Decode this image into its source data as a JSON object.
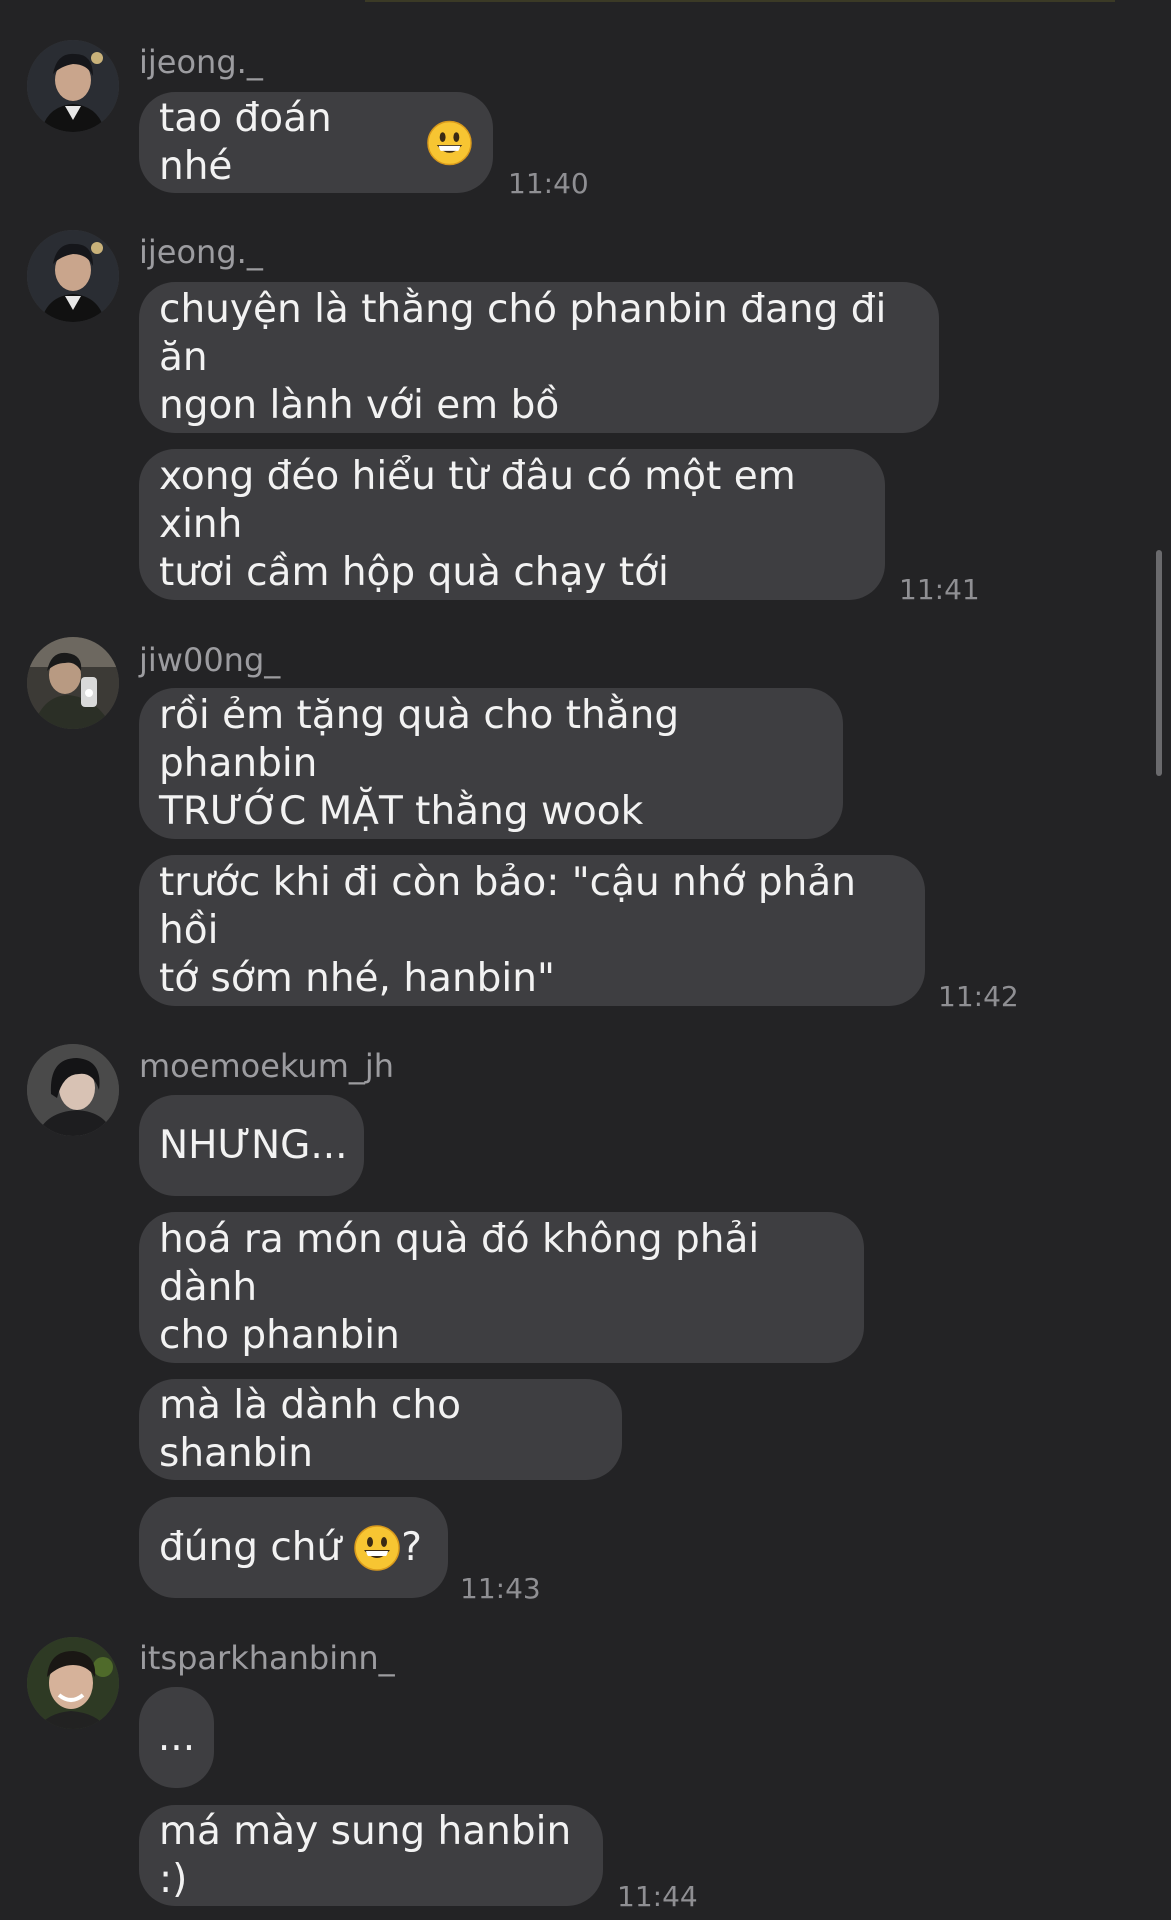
{
  "messages": [
    {
      "username": "ijeong._",
      "bubbles": [
        {
          "text": "tao đoán nhé",
          "trailing_emoji": "grinning-face-emoji"
        }
      ],
      "time": "11:40"
    },
    {
      "username": "ijeong._",
      "bubbles": [
        {
          "line1": "chuyện là thằng chó phanbin đang đi ăn",
          "line2": "ngon lành với em bồ"
        },
        {
          "line1": "xong đéo hiểu từ đâu có một em xinh",
          "line2": "tươi cầm hộp quà chạy tới"
        }
      ],
      "time": "11:41"
    },
    {
      "username": "jiw00ng_",
      "bubbles": [
        {
          "line1": "rồi ẻm tặng quà cho thằng phanbin",
          "line2": "TRƯỚC MẶT thằng wook"
        },
        {
          "line1": "trước khi đi còn bảo: \"cậu nhớ phản hồi",
          "line2": "tớ sớm nhé, hanbin\""
        }
      ],
      "time": "11:42"
    },
    {
      "username": "moemoekum_jh",
      "bubbles": [
        {
          "text": "NHƯNG..."
        },
        {
          "line1": "hoá ra món quà đó không phải dành",
          "line2": "cho phanbin"
        },
        {
          "text": "mà là dành cho shanbin"
        },
        {
          "text_before": "đúng chứ",
          "emoji": "grinning-face-emoji",
          "text_after": "?"
        }
      ],
      "time": "11:43"
    },
    {
      "username": "itsparkhanbinn_",
      "bubbles": [
        {
          "text": "..."
        },
        {
          "text": "má mày sung hanbin :)"
        }
      ],
      "time": "11:44"
    }
  ],
  "colors": {
    "background": "#232325",
    "bubble": "#3e3e41",
    "text": "#f2f2f2",
    "meta_text": "#9c9ca0",
    "emoji_face": "#f7c532"
  }
}
